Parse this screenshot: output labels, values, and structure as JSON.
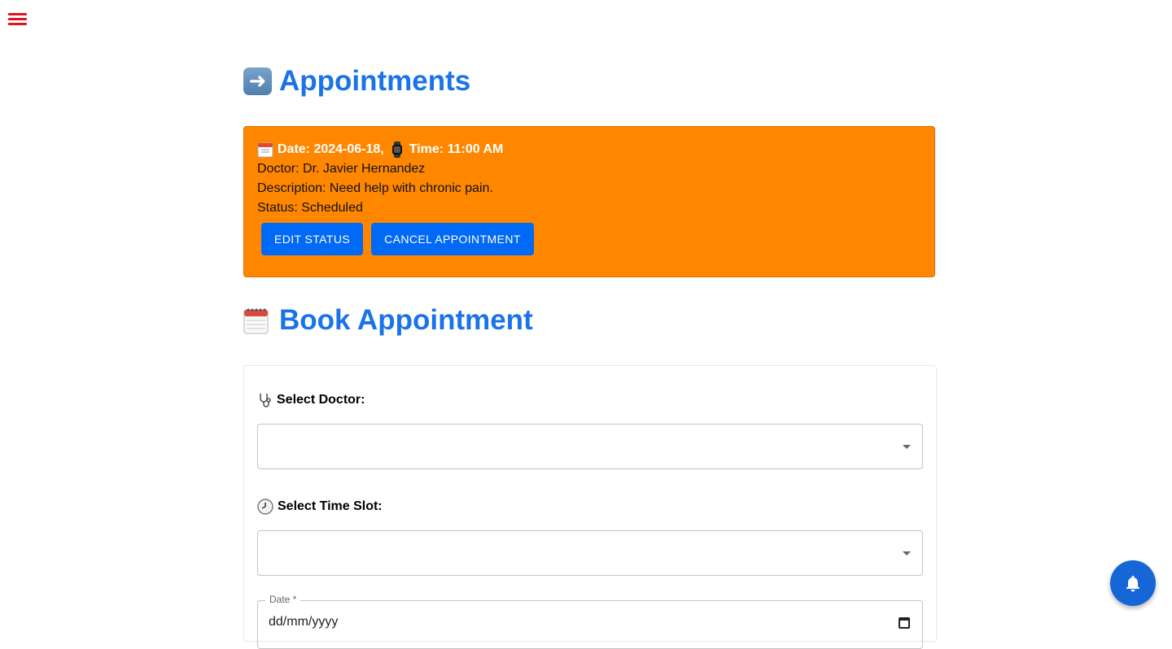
{
  "nav": {
    "menu_icon": "hamburger-menu-icon"
  },
  "appointments": {
    "title": "Appointments",
    "title_icon": "right-arrow-emoji",
    "items": [
      {
        "date_label": "Date: 2024-06-18,",
        "time_label": "Time: 11:00 AM",
        "doctor": "Doctor: Dr. Javier Hernandez",
        "description": "Description: Need help with chronic pain.",
        "status": "Status: Scheduled",
        "edit_label": "EDIT STATUS",
        "cancel_label": "CANCEL APPOINTMENT",
        "card_color": "#ff8700"
      }
    ]
  },
  "book": {
    "title": "Book Appointment",
    "title_icon": "calendar-emoji",
    "doctor_label": "Select Doctor:",
    "doctor_icon": "stethoscope-emoji",
    "doctor_value": "",
    "timeslot_label": "Select Time Slot:",
    "timeslot_icon": "clock-emoji",
    "timeslot_value": "",
    "date_label": "Date *",
    "date_value": "dd/mm/yyyy"
  },
  "colors": {
    "accent": "#1a73e8",
    "button": "#0069f5",
    "menu": "#e0141e"
  },
  "fab": {
    "icon": "bell-icon"
  }
}
